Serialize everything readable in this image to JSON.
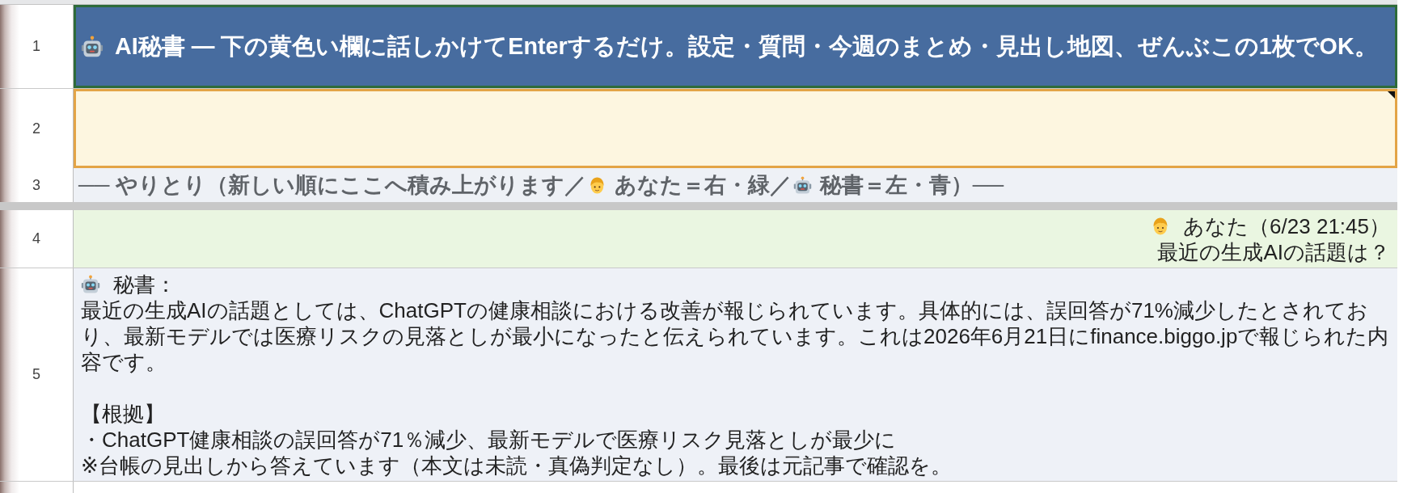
{
  "banner": {
    "row": "1",
    "text": "AI秘書 — 下の黄色い欄に話しかけてEnterするだけ。設定・質問・今週のまとめ・見出し地図、ぜんぶこの1枚でOK。"
  },
  "input_cell": {
    "row": "2",
    "note": true
  },
  "legend": {
    "row": "3",
    "lead": "── やりとり（新しい順にここへ積み上がります／",
    "items": [
      {
        "kind": "user",
        "label": "あなた＝右・緑／"
      },
      {
        "kind": "assistant",
        "label": "秘書＝左・青）──"
      }
    ]
  },
  "messages": [
    {
      "row": "4",
      "kind": "user",
      "header": "あなた（6/23 21:45）",
      "sections": [
        [
          "最近の生成AIの話題は？"
        ]
      ]
    },
    {
      "row": "5",
      "kind": "assistant",
      "header": "秘書：",
      "sections": [
        [
          "最近の生成AIの話題としては、ChatGPTの健康相談における改善が報じられています。具体的には、誤回答が71%減少したとされており、最新モデルでは医療リスクの見落としが最小になったと伝えられています。これは2026年6月21日にfinance.biggo.jpで報じられた内容です。"
        ],
        [
          "【根拠】",
          "・ChatGPT健康相談の誤回答が71％減少、最新モデルで医療リスク見落としが最少に",
          "※台帳の見出しから答えています（本文は未読・真偽判定なし）。最後は元記事で確認を。"
        ]
      ]
    }
  ]
}
